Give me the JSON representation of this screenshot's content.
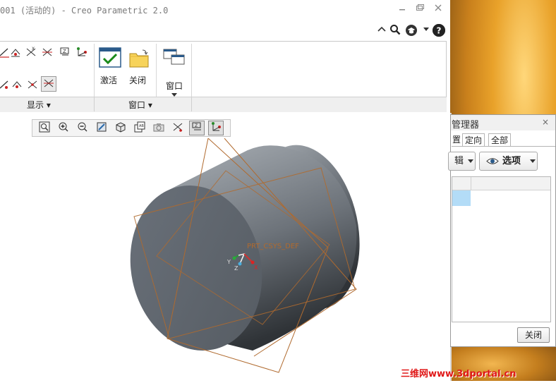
{
  "window": {
    "title": "001 (活动的) - Creo Parametric 2.0",
    "controls": [
      "minimize",
      "restore",
      "close"
    ]
  },
  "help_row": {
    "icons": [
      "collapse-ribbon-icon",
      "search-icon",
      "community-icon",
      "help-icon"
    ]
  },
  "ribbon": {
    "groups": [
      {
        "label": "显示 ▾"
      },
      {
        "label": "窗口 ▾"
      }
    ],
    "buttons": {
      "activate_label": "激活",
      "close_label": "关闭",
      "window_label": "窗口"
    }
  },
  "graphics_toolbar": {
    "items": [
      "refit",
      "zoom-in",
      "zoom-out",
      "repaint",
      "display-style",
      "saved-orientations",
      "view-manager",
      "perspective",
      "datum-display-filters",
      "datum-planes",
      "coordinate-systems"
    ]
  },
  "model": {
    "csys_label": "PRT_CSYS_DEF",
    "axis_labels": {
      "y": "Y",
      "z": "Z",
      "x": "X"
    }
  },
  "manager": {
    "title": "管理器",
    "close_glyph": "×",
    "tabs": [
      "置",
      "定向",
      "全部"
    ],
    "edit_dropdown": "辑",
    "options_dropdown": "选项",
    "close_button": "关闭"
  },
  "watermark": "三维网www.3dportal.cn",
  "colors": {
    "cylinder_side_light": "#9fa5ac",
    "cylinder_side_dark": "#3b3f44",
    "cylinder_face": "#5f6670",
    "datum_planes": "#b06a2e",
    "watermark": "#e01818",
    "tree_selection": "#b3dcf7"
  }
}
